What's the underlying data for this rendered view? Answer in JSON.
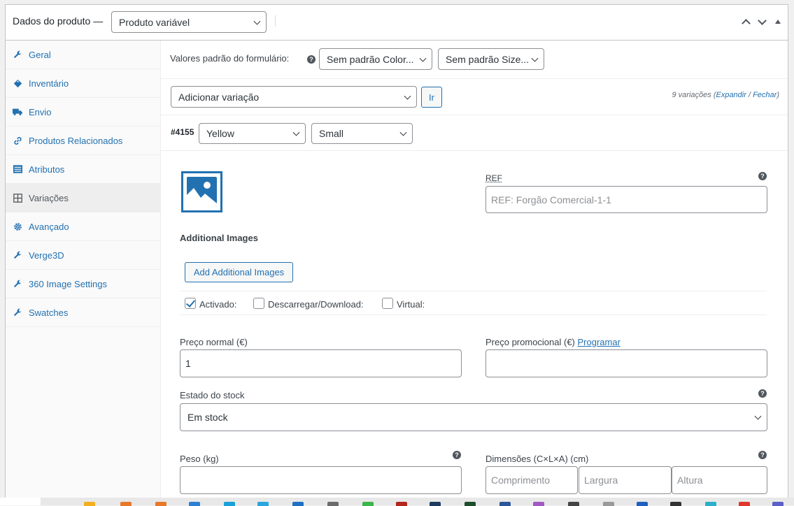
{
  "header": {
    "title": "Dados do produto —",
    "product_type": "Produto variável"
  },
  "sidebar": {
    "items": [
      {
        "label": "Geral",
        "icon": "wrench-icon"
      },
      {
        "label": "Inventário",
        "icon": "tag-icon"
      },
      {
        "label": "Envio",
        "icon": "truck-icon"
      },
      {
        "label": "Produtos Relacionados",
        "icon": "link-icon"
      },
      {
        "label": "Atributos",
        "icon": "list-icon"
      },
      {
        "label": "Variações",
        "icon": "grid-icon"
      },
      {
        "label": "Avançado",
        "icon": "gear-icon"
      },
      {
        "label": "Verge3D",
        "icon": "wrench-icon"
      },
      {
        "label": "360 Image Settings",
        "icon": "wrench-icon"
      },
      {
        "label": "Swatches",
        "icon": "wrench-icon"
      }
    ]
  },
  "defaults": {
    "label": "Valores padrão do formulário:",
    "color_select": "Sem padrão Color...",
    "size_select": "Sem padrão Size..."
  },
  "variation_actions": {
    "select": "Adicionar variação",
    "go_label": "Ir",
    "count_text": "9 variações",
    "open_paren": "(",
    "expand": "Expandir",
    "slash": " / ",
    "close": "Fechar",
    "close_paren": ")"
  },
  "variation": {
    "id": "#4155",
    "color": "Yellow",
    "size": "Small",
    "ref_label": "REF",
    "ref_placeholder": "REF: Forgão Comercial-1-1",
    "additional_images_label": "Additional Images",
    "add_images_button": "Add Additional Images",
    "enabled_label": "Activado:",
    "enabled_checked": true,
    "download_label": "Descarregar/Download:",
    "download_checked": false,
    "virtual_label": "Virtual:",
    "virtual_checked": false,
    "regular_price_label": "Preço normal (€)",
    "regular_price_value": "1",
    "sale_price_label": "Preço promocional (€)",
    "schedule_link": "Programar",
    "stock_status_label": "Estado do stock",
    "stock_status_value": "Em stock",
    "weight_label": "Peso (kg)",
    "dimensions_label": "Dimensões (C×L×A) (cm)",
    "length_placeholder": "Comprimento",
    "width_placeholder": "Largura",
    "height_placeholder": "Altura"
  },
  "colors": {
    "accent": "#2271b1",
    "text": "#3c434a",
    "border": "#8c8f94"
  }
}
